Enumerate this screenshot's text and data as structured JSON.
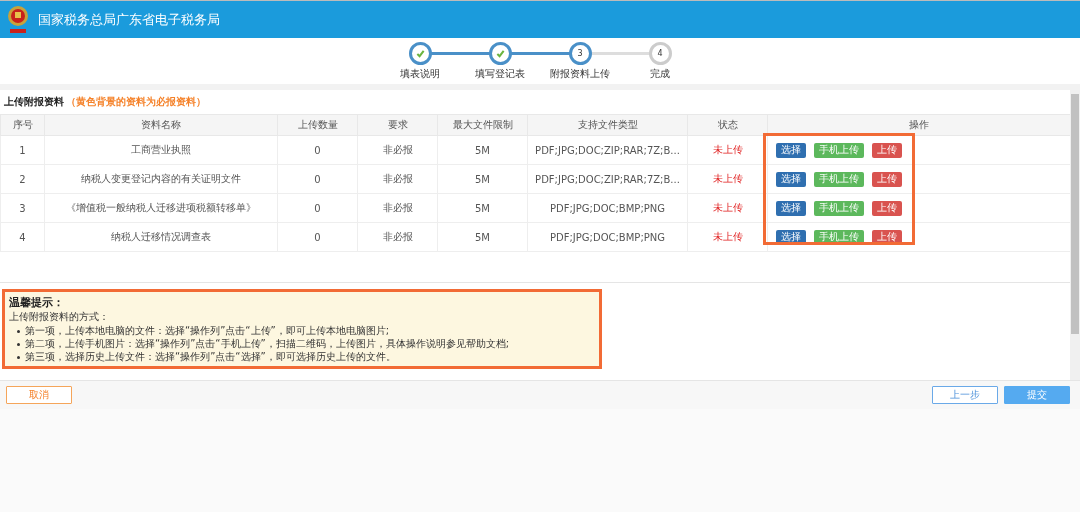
{
  "header": {
    "title": "国家税务总局广东省电子税务局"
  },
  "steps": [
    {
      "label": "填表说明",
      "kind": "done"
    },
    {
      "label": "填写登记表",
      "kind": "done"
    },
    {
      "label": "附报资料上传",
      "kind": "current",
      "number": "3"
    },
    {
      "label": "完成",
      "kind": "pending",
      "number": "4"
    }
  ],
  "section": {
    "title": "上传附报资料",
    "note": "（黄色背景的资料为必报资料）"
  },
  "table": {
    "columns": [
      "序号",
      "资料名称",
      "上传数量",
      "要求",
      "最大文件限制",
      "支持文件类型",
      "状态",
      "操作"
    ],
    "rows": [
      {
        "cells": [
          "1",
          "工商营业执照",
          "0",
          "非必报",
          "5M",
          "PDF;JPG;DOC;ZIP;RAR;7Z;B...",
          "未上传"
        ],
        "actions": [
          {
            "label": "选择",
            "kind": "select"
          },
          {
            "label": "手机上传",
            "kind": "mobile"
          },
          {
            "label": "上传",
            "kind": "upload"
          }
        ]
      },
      {
        "cells": [
          "2",
          "纳税人变更登记内容的有关证明文件",
          "0",
          "非必报",
          "5M",
          "PDF;JPG;DOC;ZIP;RAR;7Z;B...",
          "未上传"
        ],
        "actions": [
          {
            "label": "选择",
            "kind": "select"
          },
          {
            "label": "手机上传",
            "kind": "mobile"
          },
          {
            "label": "上传",
            "kind": "upload"
          }
        ]
      },
      {
        "cells": [
          "3",
          "《增值税一般纳税人迁移进项税额转移单》",
          "0",
          "非必报",
          "5M",
          "PDF;JPG;DOC;BMP;PNG",
          "未上传"
        ],
        "actions": [
          {
            "label": "选择",
            "kind": "select"
          },
          {
            "label": "手机上传",
            "kind": "mobile"
          },
          {
            "label": "上传",
            "kind": "upload"
          }
        ]
      },
      {
        "cells": [
          "4",
          "纳税人迁移情况调查表",
          "0",
          "非必报",
          "5M",
          "PDF;JPG;DOC;BMP;PNG",
          "未上传"
        ],
        "actions": [
          {
            "label": "选择",
            "kind": "select"
          },
          {
            "label": "手机上传",
            "kind": "mobile"
          },
          {
            "label": "上传",
            "kind": "upload"
          }
        ]
      }
    ]
  },
  "tips": {
    "title": "温馨提示：",
    "intro": "上传附报资料的方式：",
    "items": [
      "第一项，上传本地电脑的文件：选择“操作列”点击“上传”，即可上传本地电脑图片;",
      "第二项，上传手机图片：选择“操作列”点击“手机上传”，扫描二维码，上传图片，具体操作说明参见帮助文档;",
      "第三项，选择历史上传文件：选择“操作列”点击“选择”，即可选择历史上传的文件。"
    ]
  },
  "footer": {
    "buttons": [
      {
        "label": "取消",
        "kind": "cancel"
      },
      {
        "label": "上一步",
        "kind": "back"
      },
      {
        "label": "提交",
        "kind": "submit"
      }
    ]
  }
}
